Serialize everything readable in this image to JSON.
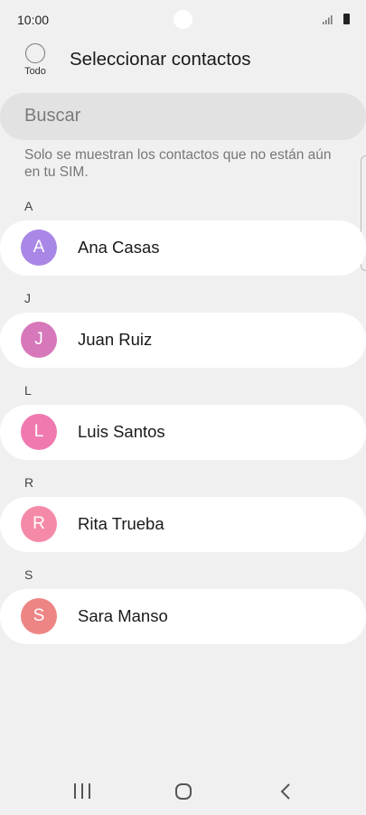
{
  "status_bar": {
    "time": "10:00"
  },
  "header": {
    "select_all_label": "Todo",
    "title": "Seleccionar contactos"
  },
  "search": {
    "placeholder": "Buscar"
  },
  "note": "Solo se muestran los contactos que no están aún en tu SIM.",
  "sections": [
    {
      "letter": "A",
      "contact": {
        "initial": "A",
        "name": "Ana Casas",
        "avatar_color": "#a987e6"
      }
    },
    {
      "letter": "J",
      "contact": {
        "initial": "J",
        "name": "Juan Ruiz",
        "avatar_color": "#d678b9"
      }
    },
    {
      "letter": "L",
      "contact": {
        "initial": "L",
        "name": "Luis Santos",
        "avatar_color": "#f07ab0"
      }
    },
    {
      "letter": "R",
      "contact": {
        "initial": "R",
        "name": "Rita Trueba",
        "avatar_color": "#f58aa8"
      }
    },
    {
      "letter": "S",
      "contact": {
        "initial": "S",
        "name": "Sara Manso",
        "avatar_color": "#ee8585"
      }
    }
  ],
  "icons": {
    "signal": "signal-icon",
    "battery": "battery-icon",
    "recent_apps": "recent-apps-icon",
    "home": "home-icon",
    "back": "back-icon"
  }
}
